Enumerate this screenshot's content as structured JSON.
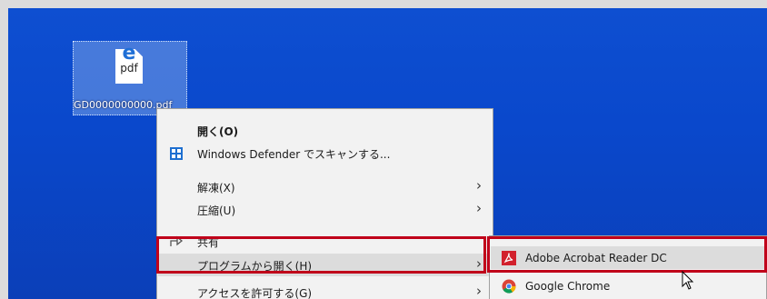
{
  "desktop": {
    "file": {
      "icon_letter": "e",
      "icon_ext": "pdf",
      "name": "GD0000000000.pdf",
      "icon": "edge-pdf-file-icon"
    }
  },
  "context_menu": {
    "items": [
      {
        "label": "開く(O)",
        "icon": null
      },
      {
        "label": "Windows Defender でスキャンする...",
        "icon": "windows-defender-icon"
      },
      {
        "label": "解凍(X)",
        "icon": null,
        "arrow": "›"
      },
      {
        "label": "圧縮(U)",
        "icon": null,
        "arrow": "›"
      },
      {
        "label": "共有",
        "icon": "share-icon"
      },
      {
        "label": "プログラムから開く(H)",
        "icon": null,
        "arrow": "›"
      },
      {
        "label": "アクセスを許可する(G)",
        "icon": null,
        "arrow": "›"
      }
    ]
  },
  "open_with_submenu": {
    "items": [
      {
        "label": "Adobe Acrobat Reader DC",
        "icon": "adobe-acrobat-icon"
      },
      {
        "label": "Google Chrome",
        "icon": "google-chrome-icon"
      }
    ]
  },
  "colors": {
    "highlight_border": "#c0001a",
    "desktop_blue": "#0a48cc",
    "menu_bg": "#f2f2f2"
  }
}
